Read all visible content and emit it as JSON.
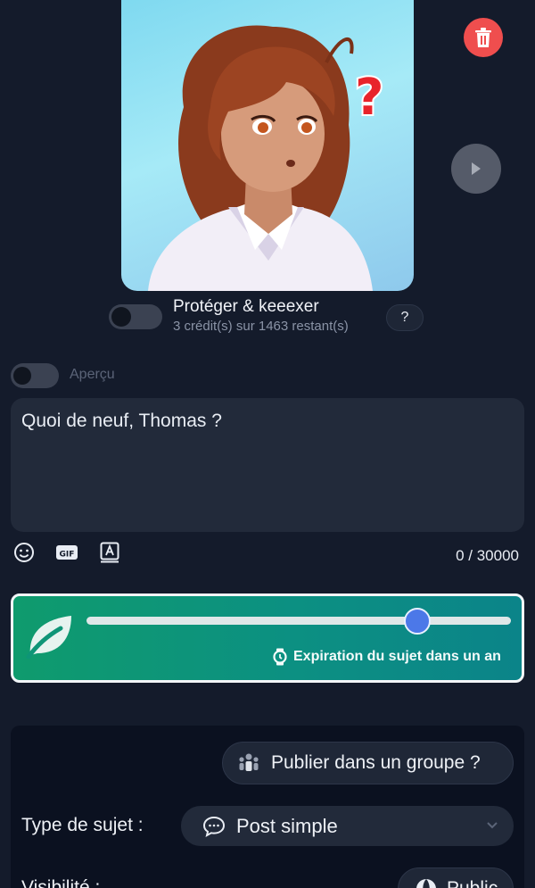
{
  "image_preview": {
    "icon": "anime-character-illustration"
  },
  "actions": {
    "delete_icon": "trash-icon",
    "next_icon": "play-arrow-icon"
  },
  "protect": {
    "title": "Protéger & keeexer",
    "credits": "3 crédit(s) sur 1463 restant(s)",
    "help_label": "?",
    "enabled": false
  },
  "preview_toggle": {
    "label": "Aperçu",
    "enabled": false
  },
  "composer": {
    "placeholder": "Quoi de neuf, Thomas ?",
    "char_count": "0 / 30000",
    "tools": [
      "emoji-icon",
      "gif-icon",
      "font-icon"
    ],
    "gif_label": "GIF"
  },
  "expiration": {
    "label": "Expiration du sujet dans un an",
    "slider_fraction": 0.78,
    "colors": {
      "start": "#0f9b6d",
      "end": "#0b8489",
      "thumb": "#4c78e8"
    }
  },
  "options": {
    "group_button": "Publier dans un groupe ?",
    "type_label": "Type de sujet :",
    "type_value": "Post simple",
    "visibility_label": "Visibilité :",
    "visibility_value": "Public"
  },
  "colors": {
    "background": "#141b2b",
    "delete": "#ef4e4e",
    "accent_text": "#eef1f6"
  }
}
